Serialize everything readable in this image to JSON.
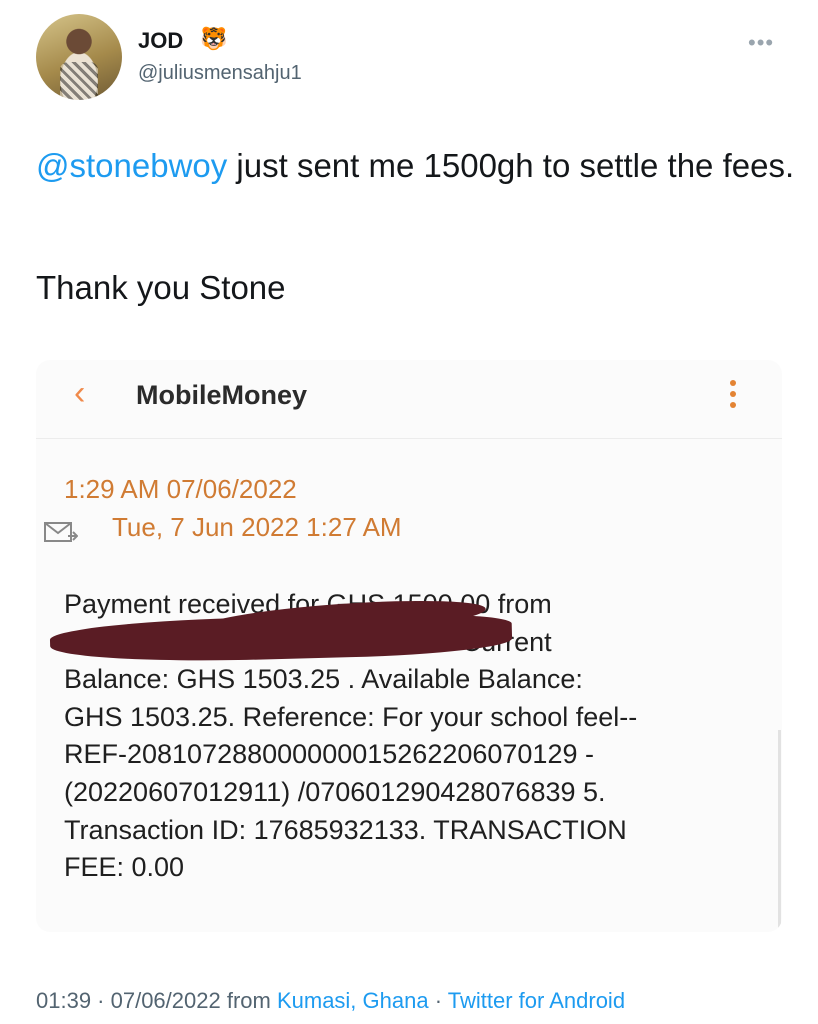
{
  "tweet": {
    "author_name": "JOD",
    "author_emoji": "🐯",
    "author_handle": "@juliusmensahju1",
    "more_icon": "more-dots-icon",
    "text_mention": "@stonebwoy",
    "text_rest": " just sent me 1500gh to settle the fees.",
    "text_line2": "Thank you Stone"
  },
  "screenshot": {
    "app_title": "MobileMoney",
    "back_icon": "chevron-left-icon",
    "menu_icon": "kebab-menu-icon",
    "time_received": "1:29 AM  07/06/2022",
    "time_sent": "Tue, 7 Jun 2022 1:27 AM",
    "mail_icon": "envelope-icon",
    "message_lines": [
      "Payment received for  GHS 1500.00 from",
      "S                                            E -  Current",
      "Balance: GHS 1503.25 . Available Balance:",
      "GHS 1503.25. Reference: For your school feel--",
      "REF-208107288000000015262206070129 -",
      "(20220607012911) /070601290428076839 5.",
      "Transaction ID: 17685932133. TRANSACTION",
      "FEE: 0.00"
    ],
    "accent_color": "#d07b33",
    "redaction_color": "#5a1c24"
  },
  "footer": {
    "timestamp": "01:39 · 07/06/2022",
    "from_label": " from ",
    "location": "Kumasi, Ghana",
    "separator": " · ",
    "client": "Twitter for Android"
  }
}
